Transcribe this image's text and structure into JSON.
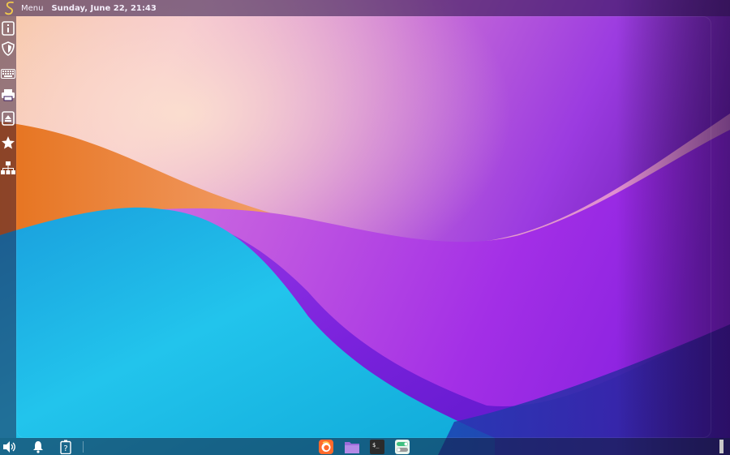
{
  "top_panel": {
    "menu_label": "Menu",
    "clock": "Sunday, June 22, 21:43",
    "logo_icon": "swirl-s-logo-icon",
    "logo_color": "#f2c94c"
  },
  "left_dock": {
    "items": [
      {
        "name": "info-icon"
      },
      {
        "name": "shield-icon"
      },
      {
        "name": "keyboard-icon"
      },
      {
        "name": "printer-icon"
      },
      {
        "name": "eject-icon"
      },
      {
        "name": "star-icon"
      },
      {
        "name": "network-icon"
      }
    ]
  },
  "bottom_panel": {
    "tray": [
      {
        "name": "volume-icon"
      },
      {
        "name": "notification-bell-icon"
      },
      {
        "name": "battery-unknown-icon"
      }
    ],
    "tasks": [
      {
        "name": "firefox-icon",
        "color": "#ff6a2b"
      },
      {
        "name": "files-folder-icon",
        "color": "#9b6bd9"
      },
      {
        "name": "terminal-icon",
        "color": "#2b2b2b"
      },
      {
        "name": "settings-toggle-icon",
        "color": "#3fbf7f"
      }
    ]
  },
  "colors": {
    "wallpaper_purple": "#8a2be2",
    "wallpaper_cyan": "#1ec8e8",
    "wallpaper_orange": "#f08a3a",
    "wallpaper_pink": "#f2b6d8"
  }
}
